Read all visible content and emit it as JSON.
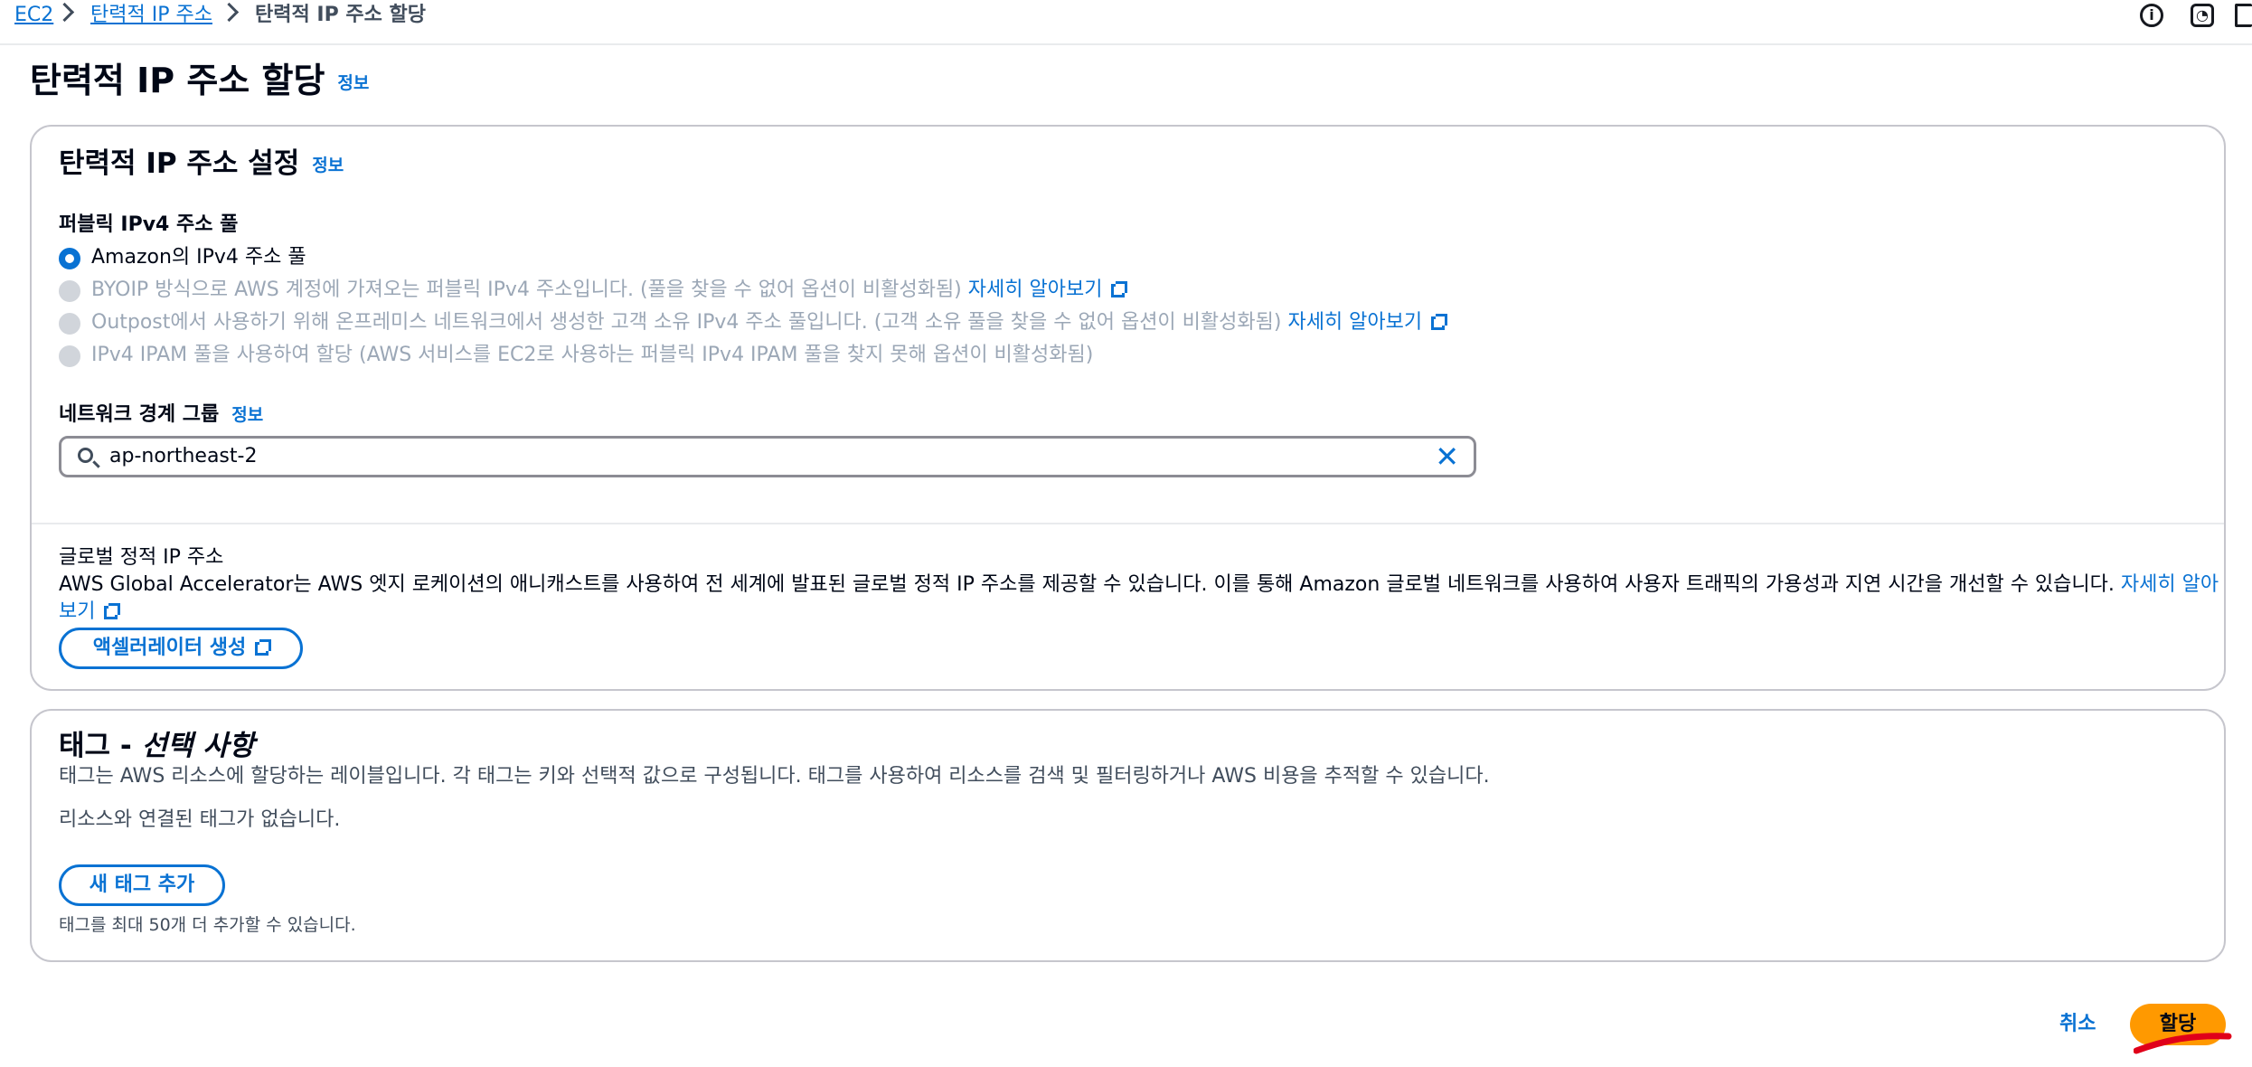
{
  "breadcrumb": {
    "items": [
      "EC2",
      "탄력적 IP 주소",
      "탄력적 IP 주소 할당"
    ]
  },
  "page": {
    "title": "탄력적 IP 주소 할당",
    "info": "정보"
  },
  "settings": {
    "title": "탄력적 IP 주소 설정",
    "info": "정보",
    "pool_label": "퍼블릭 IPv4 주소 풀",
    "options": [
      {
        "label": "Amazon의 IPv4 주소 풀",
        "selected": true,
        "disabled": false
      },
      {
        "label": "BYOIP 방식으로 AWS 계정에 가져오는 퍼블릭 IPv4 주소입니다. (풀을 찾을 수 없어 옵션이 비활성화됨)",
        "link": "자세히 알아보기",
        "selected": false,
        "disabled": true
      },
      {
        "label": "Outpost에서 사용하기 위해 온프레미스 네트워크에서 생성한 고객 소유 IPv4 주소 풀입니다. (고객 소유 풀을 찾을 수 없어 옵션이 비활성화됨)",
        "link": "자세히 알아보기",
        "selected": false,
        "disabled": true
      },
      {
        "label": "IPv4 IPAM 풀을 사용하여 할당 (AWS 서비스를 EC2로 사용하는 퍼블릭 IPv4 IPAM 풀을 찾지 못해 옵션이 비활성화됨)",
        "selected": false,
        "disabled": true
      }
    ],
    "network_border_label": "네트워크 경계 그룹",
    "network_border_info": "정보",
    "network_border_value": "ap-northeast-2",
    "global_title": "글로벌 정적 IP 주소",
    "global_desc": "AWS Global Accelerator는 AWS 엣지 로케이션의 애니캐스트를 사용하여 전 세계에 발표된 글로벌 정적 IP 주소를 제공할 수 있습니다. 이를 통해 Amazon 글로벌 네트워크를 사용하여 사용자 트래픽의 가용성과 지연 시간을 개선할 수 있습니다.",
    "global_link_part1": "자세히 알아",
    "global_link_part2": "보기",
    "create_accelerator": "액셀러레이터 생성"
  },
  "tags": {
    "title_main": "태그 - ",
    "title_optional": "선택 사항",
    "desc": "태그는 AWS 리소스에 할당하는 레이블입니다. 각 태그는 키와 선택적 값으로 구성됩니다. 태그를 사용하여 리소스를 검색 및 필터링하거나 AWS 비용을 추적할 수 있습니다.",
    "empty": "리소스와 연결된 태그가 없습니다.",
    "add_button": "새 태그 추가",
    "limit_note": "태그를 최대 50개 더 추가할 수 있습니다."
  },
  "footer": {
    "cancel": "취소",
    "assign": "할당"
  },
  "colors": {
    "link": "#0972d3",
    "primary_button": "#ff9900",
    "annotation": "#e0001a"
  }
}
